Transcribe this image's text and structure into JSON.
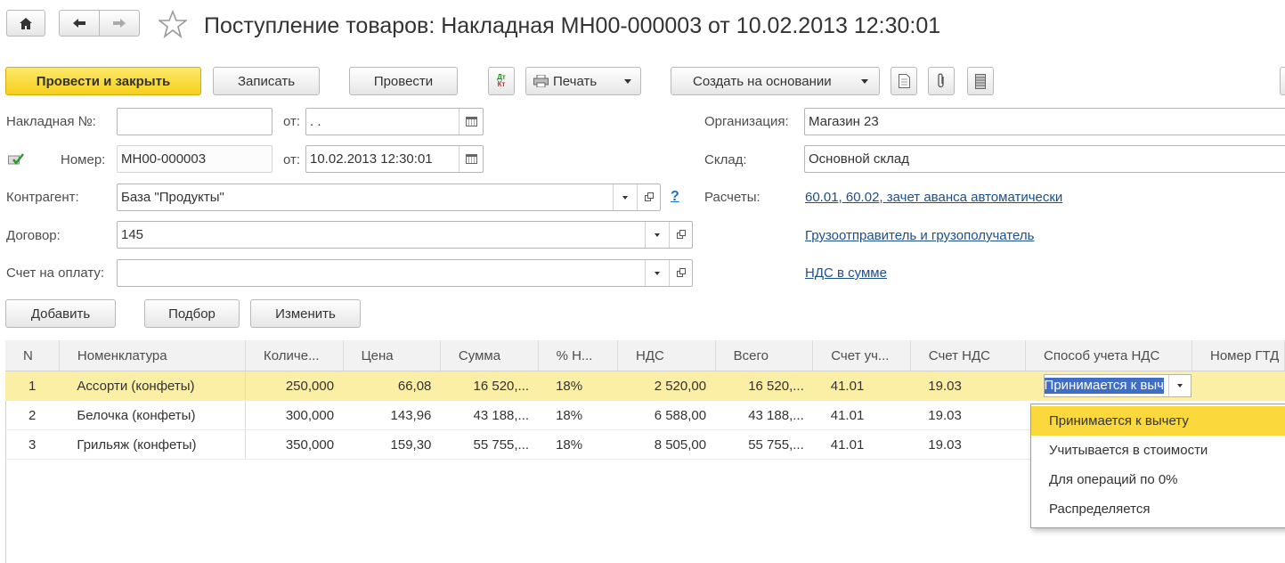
{
  "title": "Поступление товаров: Накладная МН00-000003 от 10.02.2013 12:30:01",
  "toolbar": {
    "post_close": "Провести и закрыть",
    "save": "Записать",
    "post": "Провести",
    "dt_kt": "ДтКт",
    "print": "Печать",
    "create_based": "Создать на основании"
  },
  "form": {
    "invoice_no_label": "Накладная №:",
    "invoice_no_value": "",
    "from_label": "от:",
    "invoice_date_value": " .  .",
    "number_label": "Номер:",
    "number_value": "МН00-000003",
    "date_value": "10.02.2013 12:30:01",
    "counterparty_label": "Контрагент:",
    "counterparty_value": "База \"Продукты\"",
    "help": "?",
    "contract_label": "Договор:",
    "contract_value": "145",
    "payment_label": "Счет на оплату:",
    "payment_value": "",
    "org_label": "Организация:",
    "org_value": "Магазин 23",
    "warehouse_label": "Склад:",
    "warehouse_value": "Основной склад",
    "settlements_label": "Расчеты:",
    "settlements_link": "60.01, 60.02, зачет аванса автоматически",
    "shipper_link": "Грузоотправитель и грузополучатель",
    "vat_link": "НДС в сумме"
  },
  "table_toolbar": {
    "add": "Добавить",
    "pick": "Подбор",
    "edit": "Изменить"
  },
  "table": {
    "columns": [
      "N",
      "Номенклатура",
      "Количе...",
      "Цена",
      "Сумма",
      "% Н...",
      "НДС",
      "Всего",
      "Счет уч...",
      "Счет НДС",
      "Способ учета НДС",
      "Номер ГТД"
    ],
    "rows": [
      [
        "1",
        "Ассорти (конфеты)",
        "250,000",
        "66,08",
        "16 520,...",
        "18%",
        "2 520,00",
        "16 520,...",
        "41.01",
        "19.03",
        "Принимается к выч",
        ""
      ],
      [
        "2",
        "Белочка (конфеты)",
        "300,000",
        "143,96",
        "43 188,...",
        "18%",
        "6 588,00",
        "43 188,...",
        "41.01",
        "19.03",
        "",
        ""
      ],
      [
        "3",
        "Грильяж (конфеты)",
        "350,000",
        "159,30",
        "55 755,...",
        "18%",
        "8 505,00",
        "55 755,...",
        "41.01",
        "19.03",
        "",
        ""
      ]
    ]
  },
  "dropdown": {
    "options": [
      "Принимается к вычету",
      "Учитывается в стоимости",
      "Для операций по 0%",
      "Распределяется"
    ]
  }
}
